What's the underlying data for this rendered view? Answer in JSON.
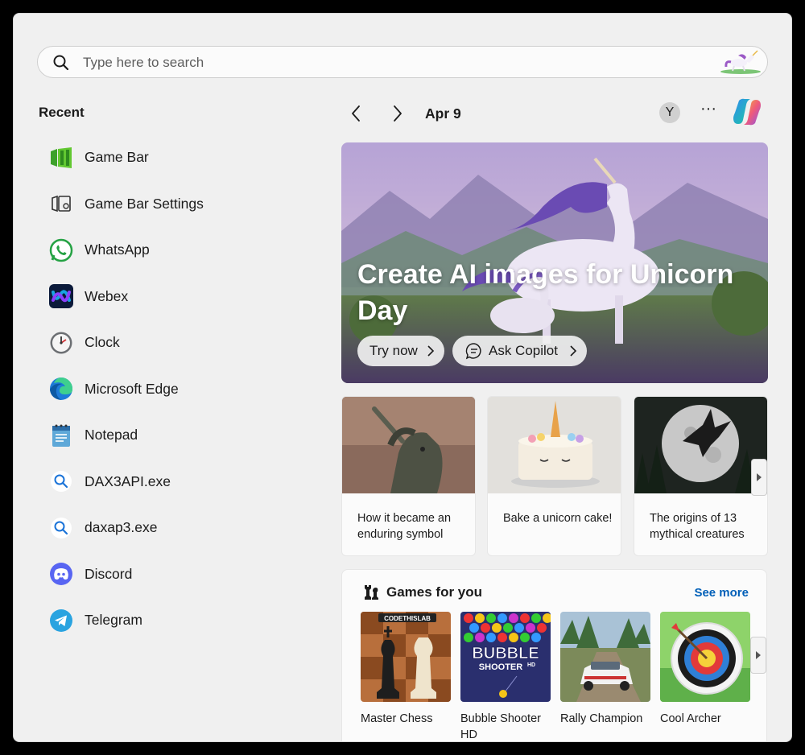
{
  "search": {
    "placeholder": "Type here to search"
  },
  "recent": {
    "title": "Recent",
    "items": [
      {
        "label": "Game Bar",
        "icon": "game-bar-icon"
      },
      {
        "label": "Game Bar Settings",
        "icon": "game-bar-settings-icon"
      },
      {
        "label": "WhatsApp",
        "icon": "whatsapp-icon"
      },
      {
        "label": "Webex",
        "icon": "webex-icon"
      },
      {
        "label": "Clock",
        "icon": "clock-icon"
      },
      {
        "label": "Microsoft Edge",
        "icon": "edge-icon"
      },
      {
        "label": "Notepad",
        "icon": "notepad-icon"
      },
      {
        "label": "DAX3API.exe",
        "icon": "search-file-icon"
      },
      {
        "label": "daxap3.exe",
        "icon": "search-file-icon"
      },
      {
        "label": "Discord",
        "icon": "discord-icon"
      },
      {
        "label": "Telegram",
        "icon": "telegram-icon"
      }
    ]
  },
  "header": {
    "date": "Apr 9",
    "avatar_initial": "Y",
    "more": "···"
  },
  "hero": {
    "title": "Create AI images for Unicorn Day",
    "try_label": "Try now",
    "ask_label": "Ask Copilot"
  },
  "cards": [
    {
      "caption": "How it became an enduring symbol"
    },
    {
      "caption": "Bake a unicorn cake!"
    },
    {
      "caption": "The origins of 13 mythical creatures"
    }
  ],
  "games": {
    "title": "Games for you",
    "see_more": "See more",
    "items": [
      {
        "label": "Master Chess",
        "badge": "CODETHISLAB"
      },
      {
        "label": "Bubble Shooter HD",
        "tile_text": "BUBBLE",
        "tile_sub": "SHOOTER",
        "tile_hd": "HD"
      },
      {
        "label": "Rally Champion"
      },
      {
        "label": "Cool Archer"
      }
    ]
  },
  "colors": {
    "accent": "#005fb8",
    "panel": "#f0f0f0",
    "card": "#fbfbfb"
  }
}
